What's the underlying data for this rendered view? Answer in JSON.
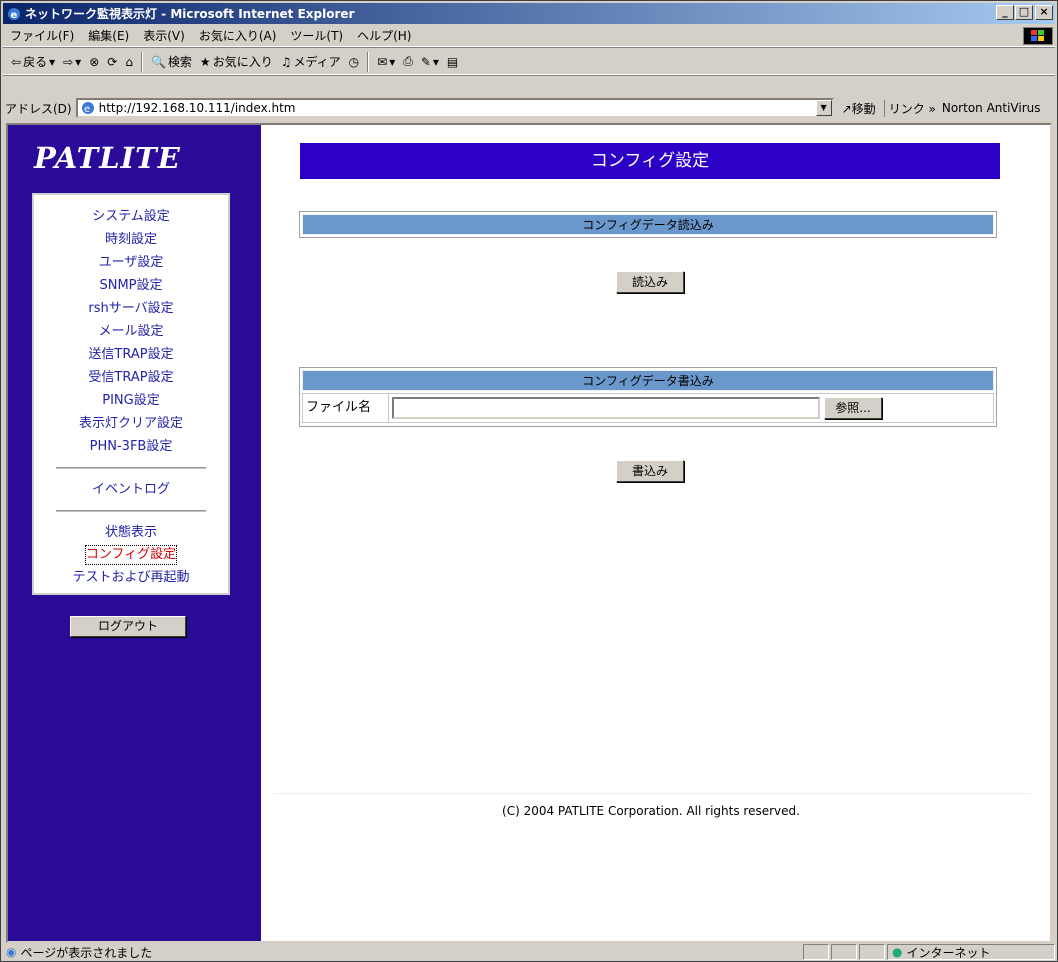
{
  "window": {
    "title": "ネットワーク監視表示灯 - Microsoft Internet Explorer",
    "buttons": [
      "_",
      "□",
      "×"
    ]
  },
  "menu": [
    "ファイル(F)",
    "編集(E)",
    "表示(V)",
    "お気に入り(A)",
    "ツール(T)",
    "ヘルプ(H)"
  ],
  "toolbar": {
    "back": "戻る",
    "search": "検索",
    "favorites": "お気に入り",
    "media": "メディア"
  },
  "address": {
    "label": "アドレス(D)",
    "url": "http://192.168.10.111/index.htm",
    "go": "移動",
    "links": "リンク »",
    "norton": "Norton AntiVirus"
  },
  "sidebar": {
    "logo": "PATLITE",
    "items": [
      "システム設定",
      "時刻設定",
      "ユーザ設定",
      "SNMP設定",
      "rshサーバ設定",
      "メール設定",
      "送信TRAP設定",
      "受信TRAP設定",
      "PING設定",
      "表示灯クリア設定",
      "PHN-3FB設定"
    ],
    "eventlog": "イベントログ",
    "status": "状態表示",
    "config": "コンフィグ設定",
    "test": "テストおよび再起動",
    "logout": "ログアウト"
  },
  "main": {
    "title": "コンフィグ設定",
    "read_section": "コンフィグデータ読込み",
    "read_button": "読込み",
    "write_section": "コンフィグデータ書込み",
    "file_label": "ファイル名",
    "file_value": "",
    "browse_button": "参照...",
    "write_button": "書込み",
    "copyright": "(C) 2004 PATLITE Corporation. All rights reserved."
  },
  "status": {
    "message": "ページが表示されました",
    "zone": "インターネット"
  },
  "colors": {
    "sidebar": "#2a0a96",
    "header": "#2d00c8",
    "section": "#6b98cc",
    "active": "#d40000"
  }
}
